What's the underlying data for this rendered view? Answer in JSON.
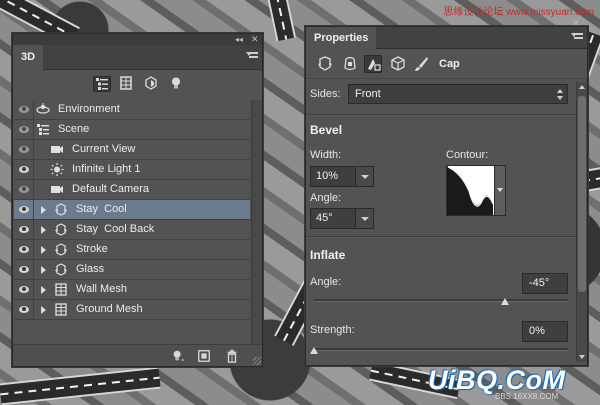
{
  "panel_3d": {
    "tab_label": "3D",
    "collapse_glyph": "◂◂",
    "close_glyph": "✕",
    "filters": [
      {
        "name": "scene-filter",
        "icon": "scene-icon",
        "active": true
      },
      {
        "name": "mesh-filter",
        "icon": "mesh-icon",
        "active": false
      },
      {
        "name": "material-filter",
        "icon": "material-icon",
        "active": false
      },
      {
        "name": "light-filter",
        "icon": "light-bulb-icon",
        "active": false
      }
    ],
    "layers": [
      {
        "label": "Environment",
        "icon": "environment-icon",
        "visible_eye": "dim",
        "twirl": false,
        "indent": 0,
        "selected": false
      },
      {
        "label": "Scene",
        "icon": "scene-icon",
        "visible_eye": "dim",
        "twirl": false,
        "indent": 0,
        "selected": false
      },
      {
        "label": "Current View",
        "icon": "camera-icon",
        "visible_eye": "dim",
        "twirl": false,
        "indent": 1,
        "selected": false
      },
      {
        "label": "Infinite Light 1",
        "icon": "sun-light-icon",
        "visible_eye": "on",
        "twirl": false,
        "indent": 1,
        "selected": false
      },
      {
        "label": "Default Camera",
        "icon": "camera-icon",
        "visible_eye": "dim",
        "twirl": false,
        "indent": 1,
        "selected": false
      },
      {
        "label": "Stay  Cool",
        "icon": "mesh-object-icon",
        "visible_eye": "on",
        "twirl": true,
        "indent": 1,
        "selected": true
      },
      {
        "label": "Stay  Cool Back",
        "icon": "mesh-object-icon",
        "visible_eye": "on",
        "twirl": true,
        "indent": 1,
        "selected": false
      },
      {
        "label": "Stroke",
        "icon": "mesh-object-icon",
        "visible_eye": "on",
        "twirl": true,
        "indent": 1,
        "selected": false
      },
      {
        "label": "Glass",
        "icon": "mesh-object-icon",
        "visible_eye": "on",
        "twirl": true,
        "indent": 1,
        "selected": false
      },
      {
        "label": "Wall Mesh",
        "icon": "grid-mesh-icon",
        "visible_eye": "on",
        "twirl": true,
        "indent": 1,
        "selected": false
      },
      {
        "label": "Ground Mesh",
        "icon": "grid-mesh-icon",
        "visible_eye": "on",
        "twirl": true,
        "indent": 1,
        "selected": false
      }
    ],
    "footer_icons": [
      "add-light-icon",
      "render-icon",
      "trash-icon"
    ]
  },
  "panel_props": {
    "tab_label": "Properties",
    "close_glyph": "✕",
    "modes": [
      "mesh-mode-icon",
      "deform-mode-icon",
      "cap-mode-icon",
      "coordinates-mode-icon",
      "brush-mode-icon"
    ],
    "active_mode_label": "Cap",
    "sides": {
      "label": "Sides:",
      "value": "Front"
    },
    "bevel": {
      "title": "Bevel",
      "width_label": "Width:",
      "width_value": "10%",
      "angle_label": "Angle:",
      "angle_value": "45°",
      "contour_label": "Contour:"
    },
    "inflate": {
      "title": "Inflate",
      "angle_label": "Angle:",
      "angle_value": "-45°",
      "angle_slider": 0.75,
      "strength_label": "Strength:",
      "strength_value": "0%",
      "strength_slider": 0.0
    }
  },
  "watermarks": {
    "top": "思缘设计论坛  www.missyuan.com",
    "bottom": "UiBQ.CoM",
    "bottom_small": "BBS.16XX8.COM"
  },
  "colors": {
    "panel_bg": "#535353",
    "selected_row": "#6b7b8e",
    "watermark_red": "#c62828",
    "watermark_blue": "#1a6bb3"
  }
}
